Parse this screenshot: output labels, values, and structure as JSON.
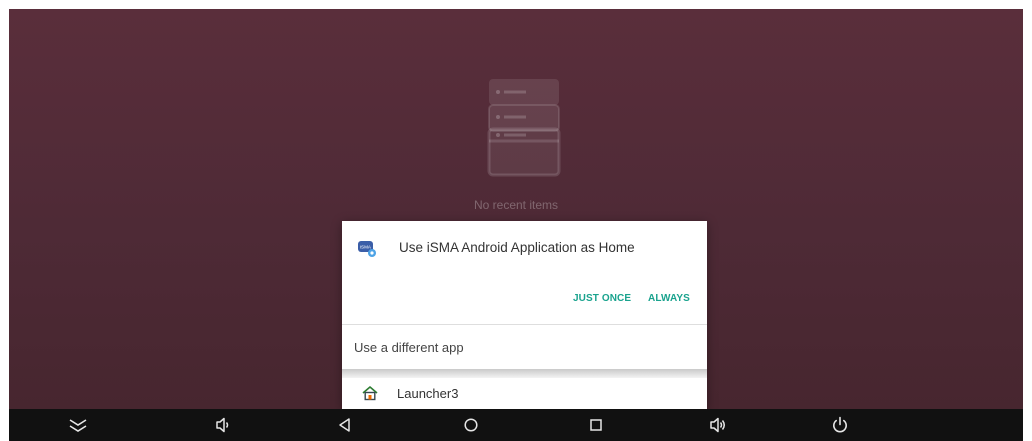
{
  "recents": {
    "empty_text": "No recent items",
    "icon": "stacked-cards-icon"
  },
  "dialog": {
    "title": "Use iSMA Android Application as Home",
    "app_icon": "isma-app-icon",
    "app_icon_text": "iSMA",
    "just_once_label": "JUST ONCE",
    "always_label": "ALWAYS",
    "different_app_label": "Use a different app",
    "apps": [
      {
        "label": "Launcher3",
        "icon": "launcher3-home-icon"
      }
    ]
  },
  "navbar": {
    "buttons": [
      {
        "name": "hide-navbar-button",
        "icon": "double-chevron-down-icon"
      },
      {
        "name": "volume-down-button",
        "icon": "volume-down-icon"
      },
      {
        "name": "back-button",
        "icon": "back-triangle-icon"
      },
      {
        "name": "home-button",
        "icon": "home-circle-icon"
      },
      {
        "name": "recents-button",
        "icon": "recents-square-icon"
      },
      {
        "name": "volume-up-button",
        "icon": "volume-up-icon"
      },
      {
        "name": "power-button",
        "icon": "power-icon"
      }
    ]
  },
  "colors": {
    "accent": "#1aa38e",
    "background": "#532b38",
    "navbar": "#111111",
    "dialog": "#ffffff"
  }
}
